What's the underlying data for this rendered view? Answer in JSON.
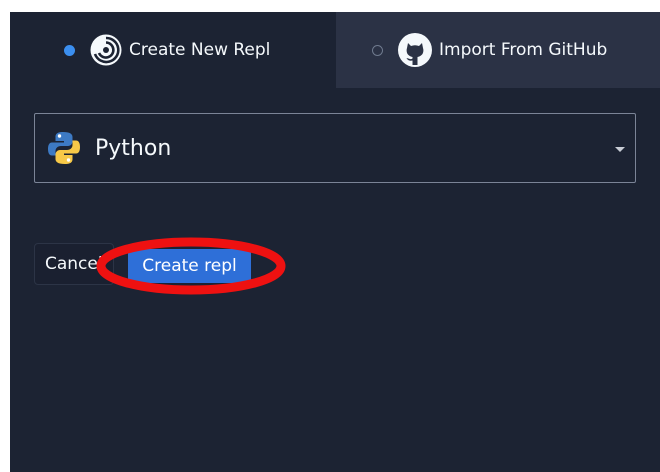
{
  "tabs": {
    "create": {
      "label": "Create New Repl",
      "selected": true,
      "icon": "replit-swirl-icon"
    },
    "import": {
      "label": "Import From GitHub",
      "selected": false,
      "icon": "github-icon"
    }
  },
  "language_select": {
    "value": "Python",
    "icon": "python-icon"
  },
  "buttons": {
    "cancel": "Cancel",
    "create": "Create repl"
  },
  "annotation": {
    "type": "red-ellipse-highlight",
    "target": "create-repl-button",
    "color": "#ee1111"
  },
  "colors": {
    "background": "#1c2333",
    "tab_inactive": "#2b3245",
    "accent": "#2e6fd8",
    "radio_active": "#3b8ff0"
  }
}
